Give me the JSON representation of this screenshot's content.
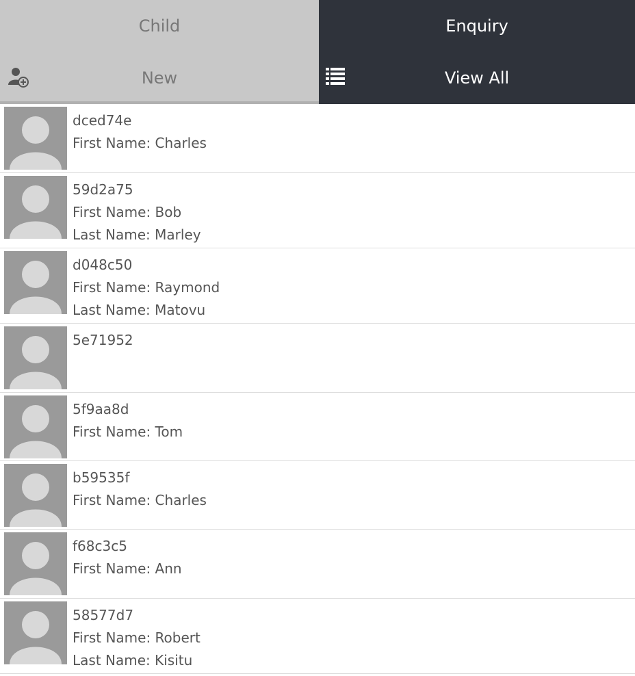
{
  "tabs": {
    "child_label": "Child",
    "enquiry_label": "Enquiry"
  },
  "actions": {
    "new_label": "New",
    "new_icon": "add-user-icon",
    "view_all_label": "View All",
    "view_all_icon": "list-icon"
  },
  "colors": {
    "active_tab_bg": "#c8c8c8",
    "dark_tab_bg": "#2f333b",
    "avatar_bg": "#9a9a9a"
  },
  "records": [
    {
      "id": "dced74e",
      "first_name": "First Name: Charles",
      "last_name": ""
    },
    {
      "id": "59d2a75",
      "first_name": "First Name: Bob",
      "last_name": "Last Name: Marley"
    },
    {
      "id": "d048c50",
      "first_name": "First Name: Raymond",
      "last_name": "Last Name: Matovu"
    },
    {
      "id": "5e71952",
      "first_name": "",
      "last_name": ""
    },
    {
      "id": "5f9aa8d",
      "first_name": "First Name: Tom",
      "last_name": ""
    },
    {
      "id": "b59535f",
      "first_name": "First Name: Charles",
      "last_name": ""
    },
    {
      "id": "f68c3c5",
      "first_name": "First Name: Ann",
      "last_name": ""
    },
    {
      "id": "58577d7",
      "first_name": "First Name: Robert",
      "last_name": "Last Name: Kisitu"
    }
  ]
}
